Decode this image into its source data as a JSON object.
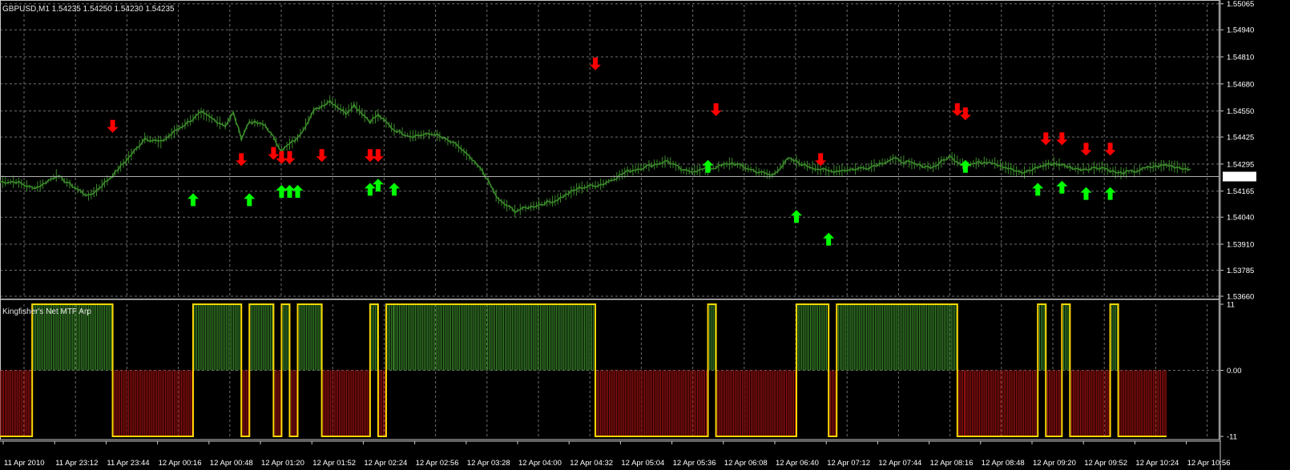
{
  "chart_data": {
    "type": "line",
    "symbol": "GBPUSD,M1",
    "ohlc_header": "1.54235 1.54250 1.54230 1.54235",
    "current_price_label": "1.54235",
    "price_panel": {
      "ylim": [
        1.5366,
        1.5506
      ],
      "y_ticks": [
        "1.55065",
        "1.54940",
        "1.54810",
        "1.54680",
        "1.54550",
        "1.54425",
        "1.54295",
        "1.54165",
        "1.54040",
        "1.53910",
        "1.53785",
        "1.53660"
      ],
      "x_index_max": 148,
      "price_series": [
        [
          0,
          1.5421
        ],
        [
          2,
          1.5421
        ],
        [
          4,
          1.5418
        ],
        [
          5,
          1.5419
        ],
        [
          7,
          1.5424
        ],
        [
          9,
          1.5419
        ],
        [
          11,
          1.5414
        ],
        [
          12,
          1.5417
        ],
        [
          14,
          1.5424
        ],
        [
          17,
          1.5437
        ],
        [
          18,
          1.5442
        ],
        [
          20,
          1.544
        ],
        [
          22,
          1.5446
        ],
        [
          25,
          1.5454
        ],
        [
          28,
          1.5448
        ],
        [
          29,
          1.5454
        ],
        [
          30,
          1.5442
        ],
        [
          31,
          1.545
        ],
        [
          33,
          1.5448
        ],
        [
          35,
          1.5436
        ],
        [
          37,
          1.5442
        ],
        [
          39,
          1.5455
        ],
        [
          41,
          1.546
        ],
        [
          43,
          1.5454
        ],
        [
          44,
          1.5458
        ],
        [
          46,
          1.545
        ],
        [
          47,
          1.5453
        ],
        [
          49,
          1.5446
        ],
        [
          51,
          1.5443
        ],
        [
          54,
          1.5444
        ],
        [
          57,
          1.5438
        ],
        [
          60,
          1.5426
        ],
        [
          62,
          1.5412
        ],
        [
          64,
          1.5407
        ],
        [
          67,
          1.541
        ],
        [
          69,
          1.5412
        ],
        [
          72,
          1.5418
        ],
        [
          75,
          1.542
        ],
        [
          78,
          1.5426
        ],
        [
          80,
          1.5428
        ],
        [
          83,
          1.5431
        ],
        [
          85,
          1.5426
        ],
        [
          88,
          1.5427
        ],
        [
          91,
          1.543
        ],
        [
          94,
          1.5426
        ],
        [
          96,
          1.5424
        ],
        [
          98,
          1.5432
        ],
        [
          100,
          1.5429
        ],
        [
          103,
          1.5426
        ],
        [
          106,
          1.5427
        ],
        [
          108,
          1.5428
        ],
        [
          111,
          1.5432
        ],
        [
          114,
          1.5429
        ],
        [
          116,
          1.5428
        ],
        [
          118,
          1.5433
        ],
        [
          120,
          1.5429
        ],
        [
          123,
          1.5431
        ],
        [
          125,
          1.5428
        ],
        [
          127,
          1.5425
        ],
        [
          129,
          1.5428
        ],
        [
          131,
          1.543
        ],
        [
          134,
          1.5427
        ],
        [
          137,
          1.5428
        ],
        [
          139,
          1.5425
        ],
        [
          141,
          1.5426
        ],
        [
          143,
          1.5428
        ],
        [
          145,
          1.5429
        ],
        [
          148,
          1.5427
        ]
      ],
      "price_main": [
        [
          0,
          1.54211
        ],
        [
          3,
          1.54205
        ],
        [
          6,
          1.542
        ],
        [
          8,
          1.54188
        ],
        [
          10,
          1.5423
        ],
        [
          12,
          1.5429
        ],
        [
          14,
          1.5436
        ],
        [
          16,
          1.5442
        ],
        [
          18,
          1.54455
        ],
        [
          20,
          1.5443
        ],
        [
          22,
          1.544
        ],
        [
          24,
          1.5444
        ],
        [
          26,
          1.5448
        ],
        [
          28,
          1.545
        ],
        [
          30,
          1.5448
        ],
        [
          32,
          1.5445
        ],
        [
          34,
          1.5446
        ],
        [
          36,
          1.5444
        ],
        [
          38,
          1.5442
        ],
        [
          40,
          1.5438
        ],
        [
          42,
          1.5432
        ],
        [
          44,
          1.5426
        ],
        [
          46,
          1.542
        ],
        [
          48,
          1.5412
        ],
        [
          50,
          1.5408
        ],
        [
          52,
          1.5411
        ],
        [
          54,
          1.5415
        ],
        [
          56,
          1.5417
        ],
        [
          58,
          1.542
        ],
        [
          60,
          1.5423
        ],
        [
          62,
          1.5425
        ],
        [
          64,
          1.5427
        ],
        [
          66,
          1.5429
        ],
        [
          68,
          1.5431
        ],
        [
          70,
          1.543
        ],
        [
          72,
          1.5428
        ],
        [
          74,
          1.543
        ],
        [
          76,
          1.5431
        ],
        [
          78,
          1.5428
        ],
        [
          80,
          1.5427
        ],
        [
          82,
          1.5429
        ],
        [
          84,
          1.5432
        ],
        [
          86,
          1.5433
        ],
        [
          88,
          1.543
        ],
        [
          90,
          1.5428
        ],
        [
          92,
          1.5429
        ],
        [
          94,
          1.5431
        ],
        [
          96,
          1.543
        ],
        [
          98,
          1.5428
        ],
        [
          100,
          1.5427
        ],
        [
          102,
          1.5429
        ],
        [
          104,
          1.5431
        ],
        [
          106,
          1.5432
        ],
        [
          108,
          1.543
        ],
        [
          110,
          1.5428
        ],
        [
          112,
          1.5429
        ],
        [
          114,
          1.5431
        ],
        [
          116,
          1.5433
        ],
        [
          118,
          1.543
        ],
        [
          120,
          1.5428
        ],
        [
          122,
          1.5429
        ],
        [
          124,
          1.5432
        ],
        [
          126,
          1.5431
        ],
        [
          128,
          1.5429
        ],
        [
          130,
          1.543
        ],
        [
          132,
          1.5431
        ],
        [
          134,
          1.5429
        ],
        [
          136,
          1.5427
        ],
        [
          138,
          1.5426
        ],
        [
          140,
          1.5424
        ],
        [
          142,
          1.5423
        ],
        [
          144,
          1.5424
        ],
        [
          146,
          1.54235
        ],
        [
          148,
          1.54235
        ]
      ],
      "up_arrows": [
        {
          "x": 24,
          "y": 1.5412
        },
        {
          "x": 31,
          "y": 1.5412
        },
        {
          "x": 35,
          "y": 1.5416
        },
        {
          "x": 36,
          "y": 1.5416
        },
        {
          "x": 37,
          "y": 1.5416
        },
        {
          "x": 46,
          "y": 1.5417
        },
        {
          "x": 47,
          "y": 1.5419
        },
        {
          "x": 49,
          "y": 1.5417
        },
        {
          "x": 88,
          "y": 1.5428
        },
        {
          "x": 99,
          "y": 1.5404
        },
        {
          "x": 103,
          "y": 1.5393
        },
        {
          "x": 120,
          "y": 1.5428
        },
        {
          "x": 129,
          "y": 1.5417
        },
        {
          "x": 132,
          "y": 1.5418
        },
        {
          "x": 135,
          "y": 1.5415
        },
        {
          "x": 138,
          "y": 1.5415
        }
      ],
      "down_arrows": [
        {
          "x": 14,
          "y": 1.5448
        },
        {
          "x": 30,
          "y": 1.5432
        },
        {
          "x": 34,
          "y": 1.5435
        },
        {
          "x": 35,
          "y": 1.5433
        },
        {
          "x": 36,
          "y": 1.5433
        },
        {
          "x": 40,
          "y": 1.5434
        },
        {
          "x": 46,
          "y": 1.5434
        },
        {
          "x": 47,
          "y": 1.5434
        },
        {
          "x": 74,
          "y": 1.5478
        },
        {
          "x": 89,
          "y": 1.5456
        },
        {
          "x": 102,
          "y": 1.5432
        },
        {
          "x": 119,
          "y": 1.5456
        },
        {
          "x": 120,
          "y": 1.5454
        },
        {
          "x": 130,
          "y": 1.5442
        },
        {
          "x": 132,
          "y": 1.5442
        },
        {
          "x": 135,
          "y": 1.5437
        },
        {
          "x": 138,
          "y": 1.5437
        }
      ]
    },
    "indicator_panel": {
      "label": "Kingfisher's Net MTF Arp",
      "y_ticks": [
        "11",
        "0.00",
        "-11"
      ],
      "ylim": [
        -11,
        11
      ],
      "segments": [
        [
          0,
          4,
          -1
        ],
        [
          4,
          14,
          1
        ],
        [
          14,
          24,
          -1
        ],
        [
          24,
          30,
          1
        ],
        [
          30,
          31,
          -1
        ],
        [
          31,
          34,
          1
        ],
        [
          34,
          35,
          -1
        ],
        [
          35,
          36,
          1
        ],
        [
          36,
          37,
          -1
        ],
        [
          37,
          40,
          1
        ],
        [
          40,
          46,
          -1
        ],
        [
          46,
          47,
          1
        ],
        [
          47,
          48,
          -1
        ],
        [
          48,
          49,
          1
        ],
        [
          49,
          74,
          1
        ],
        [
          74,
          88,
          -1
        ],
        [
          88,
          89,
          1
        ],
        [
          89,
          99,
          -1
        ],
        [
          99,
          103,
          1
        ],
        [
          103,
          104,
          -1
        ],
        [
          104,
          119,
          1
        ],
        [
          119,
          120,
          -1
        ],
        [
          120,
          129,
          -1
        ],
        [
          129,
          130,
          1
        ],
        [
          130,
          132,
          -1
        ],
        [
          132,
          133,
          1
        ],
        [
          133,
          135,
          -1
        ],
        [
          135,
          138,
          -1
        ],
        [
          138,
          139,
          1
        ],
        [
          139,
          145,
          -1
        ]
      ]
    },
    "x_labels": [
      "11 Apr 2010",
      "11 Apr 23:12",
      "11 Apr 23:44",
      "12 Apr 00:16",
      "12 Apr 00:48",
      "12 Apr 01:20",
      "12 Apr 01:52",
      "12 Apr 02:24",
      "12 Apr 02:56",
      "12 Apr 03:28",
      "12 Apr 04:00",
      "12 Apr 04:32",
      "12 Apr 05:04",
      "12 Apr 05:36",
      "12 Apr 06:08",
      "12 Apr 06:40",
      "12 Apr 07:12",
      "12 Apr 07:44",
      "12 Apr 08:16",
      "12 Apr 08:48",
      "12 Apr 09:20",
      "12 Apr 09:52",
      "12 Apr 10:24",
      "12 Apr 10:56"
    ],
    "colors": {
      "background": "#000000",
      "grid": "#6e6e6e",
      "price_line": "#3a8a2a",
      "up_arrow": "#00ff00",
      "down_arrow": "#ff0000",
      "bull_fill": "#3a8a2a",
      "bear_fill": "#a01010",
      "signal_line": "#ffd700",
      "axis_text": "#ffffff",
      "current_line": "#b0b0b0"
    },
    "grid": true
  }
}
